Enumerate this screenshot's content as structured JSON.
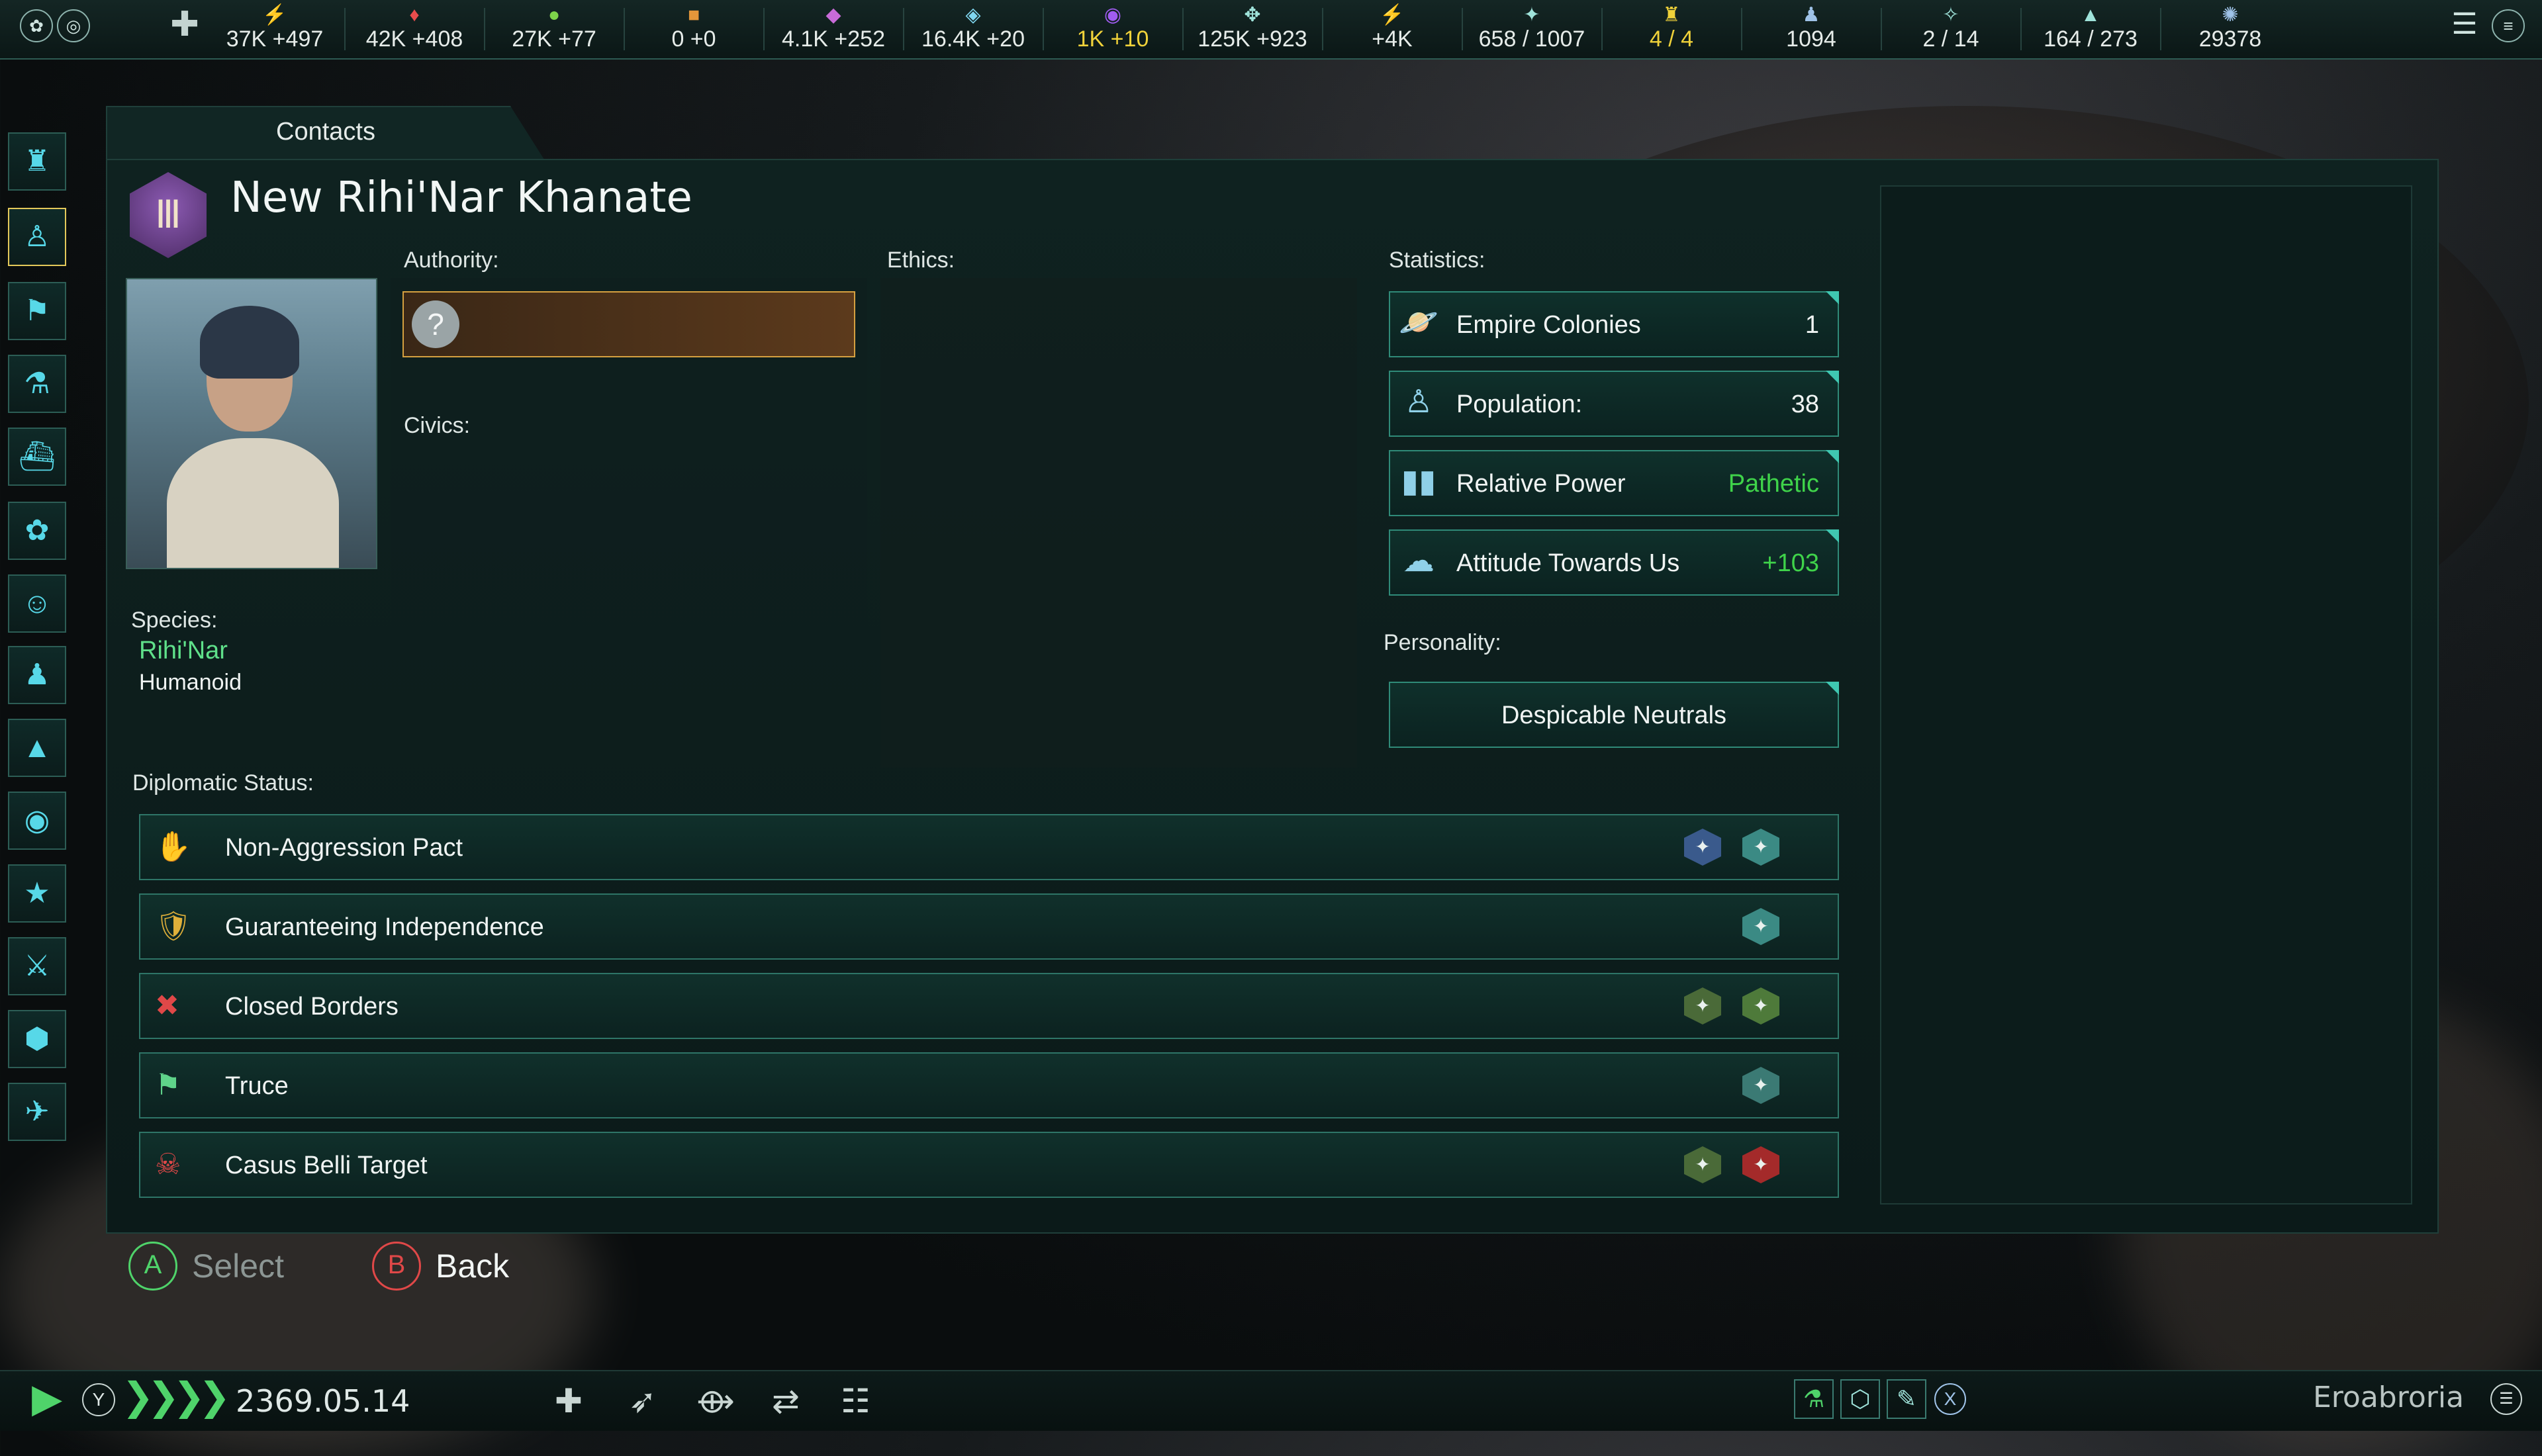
{
  "topbar": {
    "resources": [
      {
        "icon": "energy-icon",
        "glyph": "⚡",
        "value": "37K +497",
        "color": "#f0d23a"
      },
      {
        "icon": "minerals-icon",
        "glyph": "♦",
        "value": "42K +408",
        "color": "#e84c4c"
      },
      {
        "icon": "food-icon",
        "glyph": "●",
        "value": "27K +77",
        "color": "#7dd34a"
      },
      {
        "icon": "trade-icon",
        "glyph": "■",
        "value": "0 +0",
        "color": "#e3963a"
      },
      {
        "icon": "alloys-icon",
        "glyph": "◆",
        "value": "4.1K +252",
        "color": "#c86bd8"
      },
      {
        "icon": "consumer-goods-icon",
        "glyph": "◈",
        "value": "16.4K +20",
        "color": "#7fd6f0"
      },
      {
        "icon": "influence-icon",
        "glyph": "◉",
        "value": "1K +10",
        "color": "#a05cf0"
      },
      {
        "icon": "unity-icon",
        "glyph": "✥",
        "value": "125K +923",
        "color": "#9fe3da"
      },
      {
        "icon": "research-icon",
        "glyph": "⚡",
        "value": "+4K",
        "color": "#d7e3e0"
      },
      {
        "icon": "naval-capacity-icon",
        "glyph": "✦",
        "value": "658 / 1007",
        "color": "#9fe3da"
      },
      {
        "icon": "envoys-icon",
        "glyph": "♜",
        "value": "4 / 4",
        "color": "#f0d23a"
      },
      {
        "icon": "pops-icon",
        "glyph": "♟",
        "value": "1094",
        "color": "#9fc3e8"
      },
      {
        "icon": "starbase-icon",
        "glyph": "✧",
        "value": "2 / 14",
        "color": "#9fe3da"
      },
      {
        "icon": "fleet-icon",
        "glyph": "▲",
        "value": "164 / 273",
        "color": "#9fe3da"
      },
      {
        "icon": "planets-icon",
        "glyph": "✺",
        "value": "29378",
        "color": "#9fc3e8"
      }
    ]
  },
  "tab": {
    "label": "Contacts"
  },
  "empire": {
    "name": "New Rihi'Nar Khanate",
    "emblem_glyph": "Ⅲ",
    "species_label": "Species:",
    "species": "Rihi'Nar",
    "species_class": "Humanoid"
  },
  "labels": {
    "authority": "Authority:",
    "ethics": "Ethics:",
    "civics": "Civics:",
    "statistics": "Statistics:",
    "personality": "Personality:",
    "diplomatic_status": "Diplomatic Status:",
    "authority_icon": "?"
  },
  "statistics": [
    {
      "icon": "planet-icon",
      "glyph": "🪐",
      "label": "Empire Colonies",
      "value": "1",
      "value_color": "#f0f4f3"
    },
    {
      "icon": "population-icon",
      "glyph": "♙",
      "label": "Population:",
      "value": "38",
      "value_color": "#f0f4f3"
    },
    {
      "icon": "relative-power-icon",
      "glyph": "▮▮",
      "label": "Relative Power",
      "value": "Pathetic",
      "value_color": "#3fd34a"
    },
    {
      "icon": "attitude-icon",
      "glyph": "☁",
      "label": "Attitude Towards Us",
      "value": "+103",
      "value_color": "#3fd34a"
    }
  ],
  "personality": "Despicable Neutrals",
  "diplomatic": [
    {
      "icon": "non-aggression-pact-icon",
      "glyph": "✋",
      "label": "Non-Aggression Pact",
      "flags": [
        {
          "name": "empire-flag-blue",
          "color": "#3a5a8c"
        },
        {
          "name": "empire-flag-teal",
          "color": "#3b8a84"
        }
      ]
    },
    {
      "icon": "guarantee-icon",
      "glyph": "🛡",
      "label": "Guaranteeing Independence",
      "flags": [
        {
          "name": "empire-flag-teal",
          "color": "#3b8a84"
        }
      ]
    },
    {
      "icon": "closed-borders-icon",
      "glyph": "✖",
      "label": "Closed Borders",
      "flags": [
        {
          "name": "empire-flag-green",
          "color": "#4a6a38"
        },
        {
          "name": "empire-flag-olive",
          "color": "#4e7a3a"
        }
      ]
    },
    {
      "icon": "truce-icon",
      "glyph": "⚑",
      "label": "Truce",
      "flags": [
        {
          "name": "empire-flag-teal",
          "color": "#3b7a74"
        }
      ]
    },
    {
      "icon": "casus-belli-icon",
      "glyph": "☠",
      "label": "Casus Belli Target",
      "flags": [
        {
          "name": "empire-flag-green",
          "color": "#4a6a38"
        },
        {
          "name": "empire-flag-red",
          "color": "#a42a2a"
        }
      ]
    }
  ],
  "hints": {
    "select_key": "A",
    "select_label": "Select",
    "back_key": "B",
    "back_label": "Back"
  },
  "bottombar": {
    "date": "2369.05.14",
    "speed_key": "Y",
    "player_name": "Eroabroria",
    "x_key": "X"
  }
}
